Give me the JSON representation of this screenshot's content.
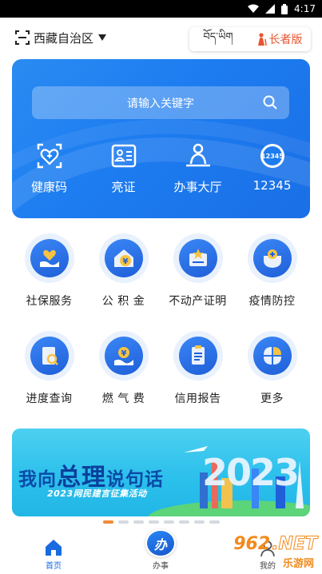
{
  "status_bar": {
    "time": "4:17"
  },
  "header": {
    "region": "西藏自治区",
    "language_toggle": "བོད་ཡིག",
    "elder_mode": "长者版"
  },
  "search": {
    "placeholder": "请输入关键字"
  },
  "quick_actions": [
    {
      "label": "健康码",
      "icon": "health-code-icon"
    },
    {
      "label": "亮证",
      "icon": "id-card-icon"
    },
    {
      "label": "办事大厅",
      "icon": "service-hall-icon"
    },
    {
      "label": "12345",
      "icon": "hotline-12345-icon"
    }
  ],
  "services": [
    {
      "label": "社保服务",
      "icon": "social-security-icon"
    },
    {
      "label": "公 积 金",
      "icon": "housing-fund-icon"
    },
    {
      "label": "不动产证明",
      "icon": "real-estate-icon"
    },
    {
      "label": "疫情防控",
      "icon": "epidemic-control-icon"
    },
    {
      "label": "进度查询",
      "icon": "progress-query-icon"
    },
    {
      "label": "燃 气 费",
      "icon": "gas-fee-icon"
    },
    {
      "label": "信用报告",
      "icon": "credit-report-icon"
    },
    {
      "label": "更多",
      "icon": "more-icon"
    }
  ],
  "banner": {
    "title_part1": "我向",
    "title_big": "总理",
    "title_part2": "说句话",
    "subtitle": "2023网民建言征集活动",
    "year": "2023",
    "pages": 8,
    "active_page": 1
  },
  "bottom_nav": {
    "home": "首页",
    "service": "办事",
    "service_badge": "办",
    "mine": "我的"
  },
  "watermark": {
    "brand": "962",
    "net": ".NET",
    "sub": "乐游网"
  },
  "colors": {
    "primary": "#1d7cf0",
    "elder": "#e8542e",
    "dot_active": "#f08a36"
  }
}
